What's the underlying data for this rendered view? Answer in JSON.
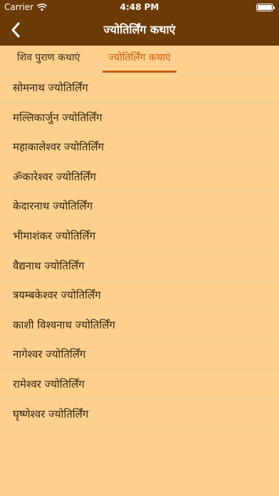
{
  "status_bar": {
    "carrier": "Carrier",
    "time": "4:48 PM"
  },
  "nav": {
    "title": "ज्योतिर्लिंग कथाएं",
    "back_icon": "chevron-left-icon"
  },
  "tabs": [
    {
      "label": "शिव पुराण कथाएं",
      "selected": false
    },
    {
      "label": "ज्योतिर्लिंग कथाएं",
      "selected": true
    }
  ],
  "list_items": [
    "सोमनाथ ज्योतिर्लिंग",
    "मल्लिकार्जुन ज्योतिर्लिंग",
    "महाकालेश्वर ज्योतिर्लिंग",
    "ॐकारेश्वर ज्योतिर्लिंग",
    "केदारनाथ ज्योतिर्लिंग",
    "भीमाशंकर ज्योतिर्लिंग",
    "वैद्यनाथ ज्योतिर्लिंग",
    "त्रयम्बकेश्वर ज्योतिर्लिंग",
    "काशी विश्वनाथ ज्योतिर्लिंग",
    "नागेश्वर ज्योतिर्लिंग",
    "रामेश्वर ज्योतिर्लिंग",
    "घृष्णेश्वर ज्योतिर्लिंग"
  ],
  "colors": {
    "header": "#6B3A06",
    "background": "#FDD08E",
    "accent": "#C85F0B"
  }
}
